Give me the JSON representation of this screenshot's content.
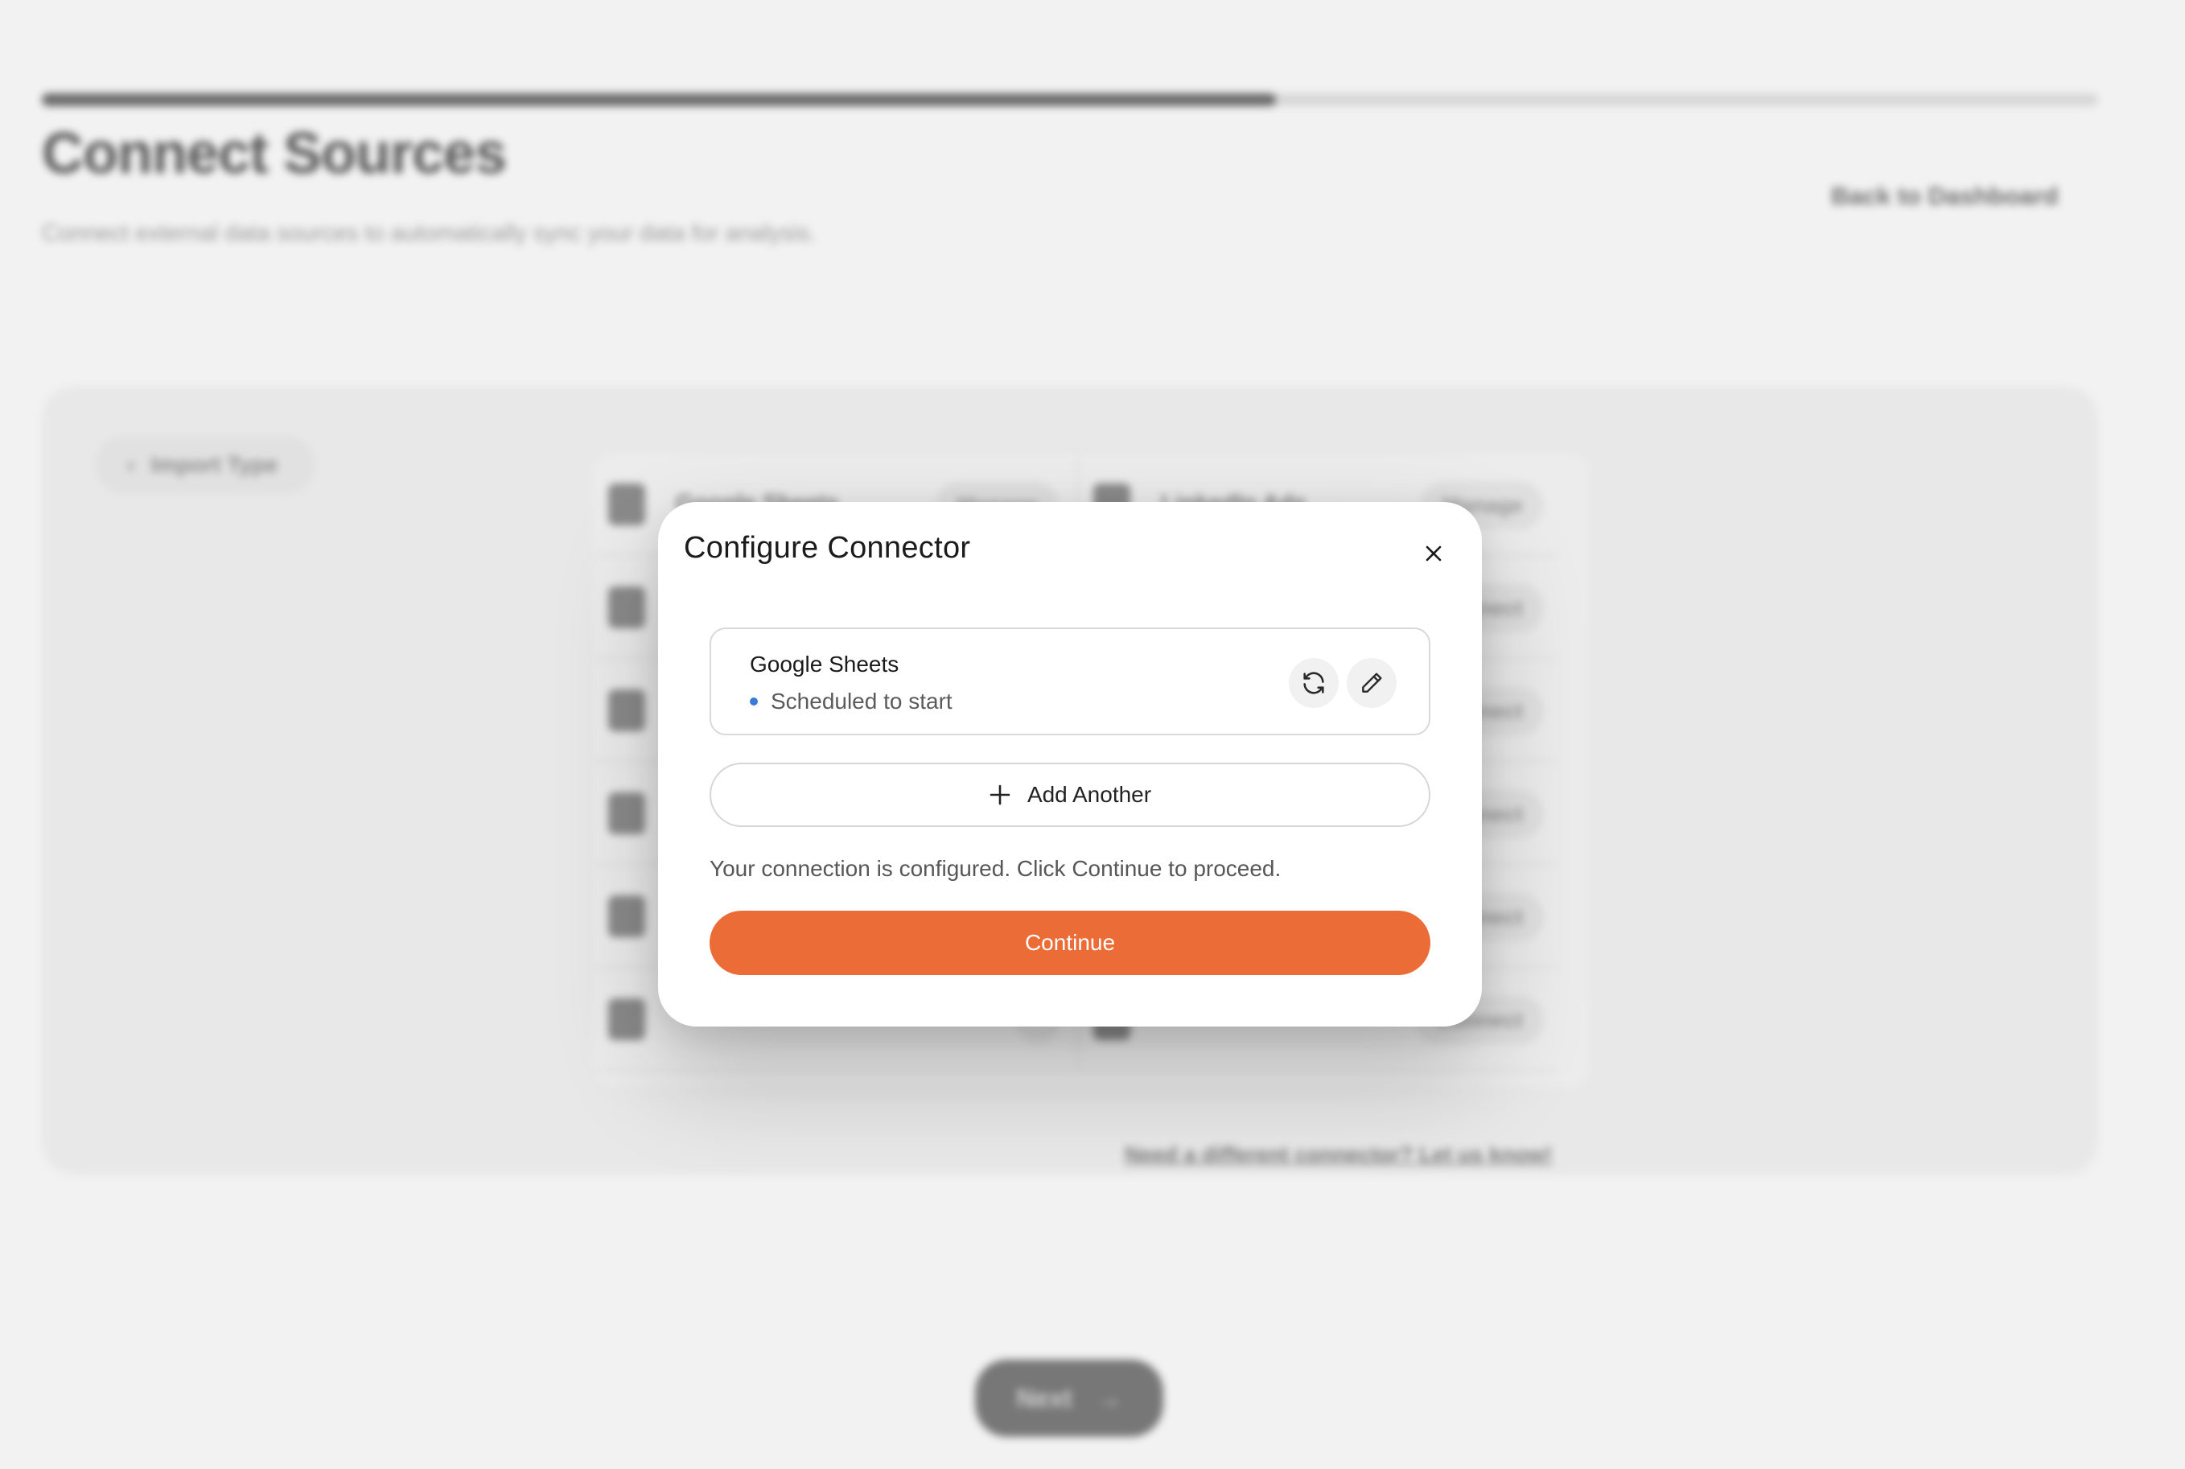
{
  "background": {
    "page_title": "Connect Sources",
    "page_subtitle": "Connect external data sources to automatically sync your data for analysis.",
    "back_to_dashboard": "Back to Dashboard",
    "import_type_label": "Import Type",
    "progress_fraction": 0.6,
    "connectors_left": [
      {
        "name": "Google Sheets",
        "action": "Manage"
      },
      {
        "name": "",
        "action": ""
      },
      {
        "name": "",
        "action": ""
      },
      {
        "name": "",
        "action": ""
      },
      {
        "name": "",
        "action": ""
      },
      {
        "name": "",
        "action": ""
      }
    ],
    "connectors_right": [
      {
        "name": "LinkedIn Ads",
        "action": "Manage"
      },
      {
        "name": "",
        "action": "Connect"
      },
      {
        "name": "",
        "action": "Connect"
      },
      {
        "name": "",
        "action": "Connect"
      },
      {
        "name": "",
        "action": "Connect"
      },
      {
        "name": "",
        "action": "Connect"
      }
    ],
    "need_connector_link": "Need a different connector? Let us know!",
    "next_label": "Next"
  },
  "modal": {
    "title": "Configure Connector",
    "connector": {
      "name": "Google Sheets",
      "status": "Scheduled to start",
      "status_color": "#3a7bd5"
    },
    "add_another_label": "Add Another",
    "help_text": "Your connection is configured. Click Continue to proceed.",
    "continue_label": "Continue",
    "accent_color": "#eb6c36"
  }
}
